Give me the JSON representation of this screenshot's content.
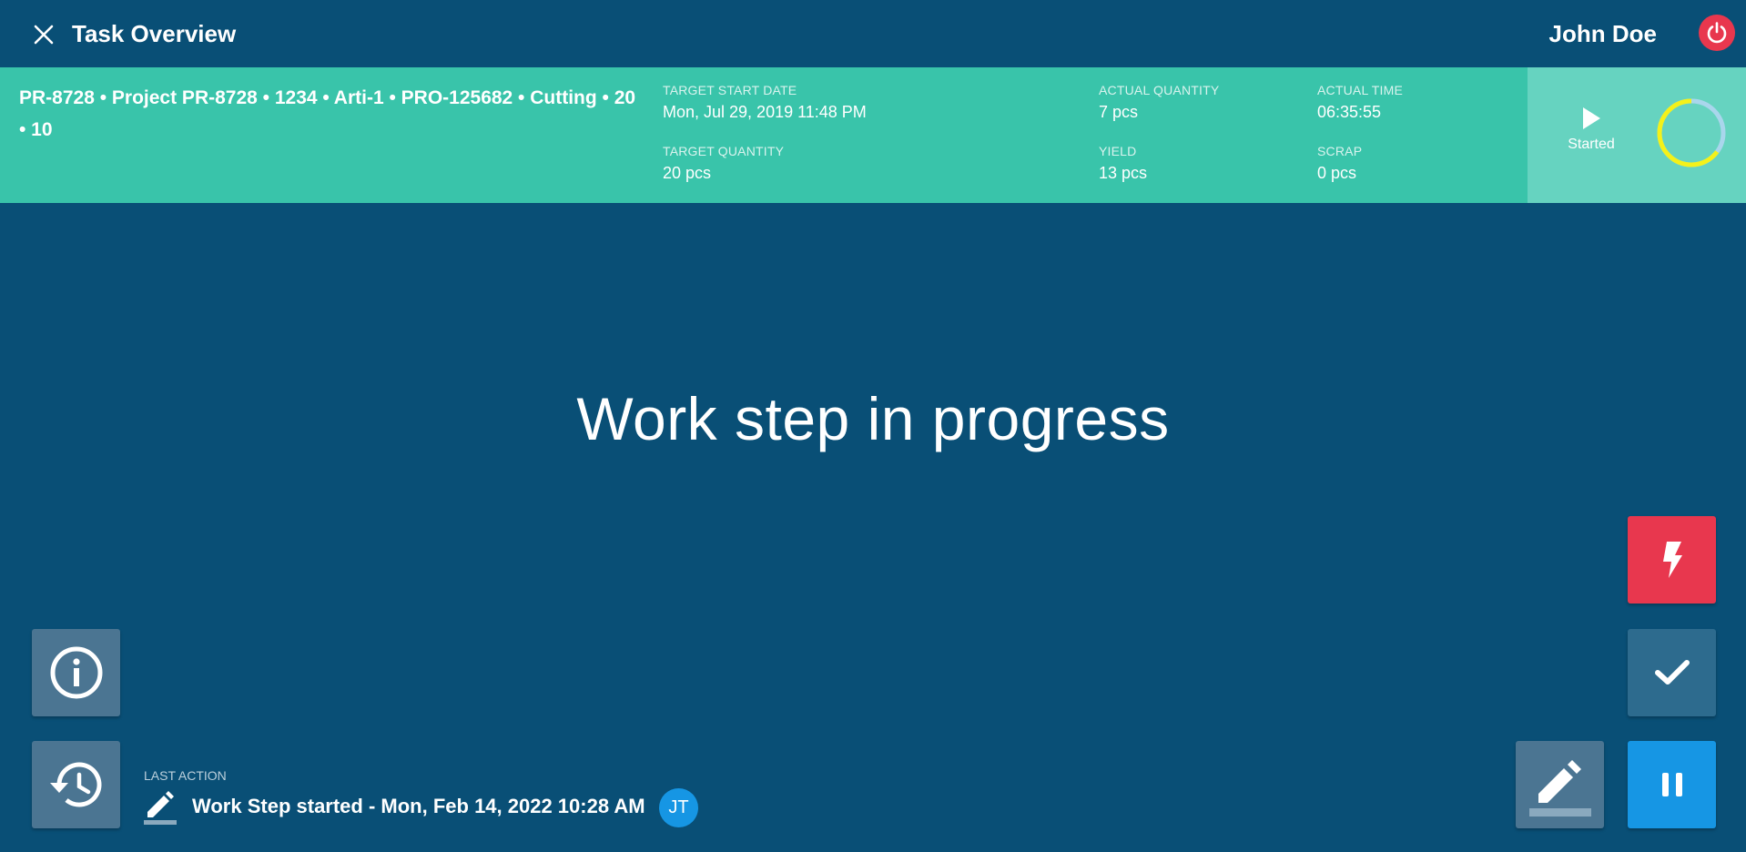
{
  "header": {
    "title": "Task Overview",
    "user_name": "John Doe"
  },
  "banner": {
    "order_description": "PR-8728 • Project PR-8728 • 1234 • Arti-1 • PRO-125682 • Cutting • 20 • 10",
    "fields": {
      "target_start_date": {
        "label": "TARGET START DATE",
        "value": "Mon, Jul 29, 2019 11:48 PM"
      },
      "target_quantity": {
        "label": "TARGET QUANTITY",
        "value": "20 pcs"
      },
      "actual_quantity": {
        "label": "ACTUAL QUANTITY",
        "value": "7 pcs"
      },
      "yield": {
        "label": "YIELD",
        "value": "13 pcs"
      },
      "actual_time": {
        "label": "ACTUAL TIME",
        "value": "06:35:55"
      },
      "scrap": {
        "label": "SCRAP",
        "value": "0 pcs"
      }
    },
    "status": {
      "label": "Started",
      "progress_fraction": 0.65
    }
  },
  "main": {
    "message": "Work step in progress"
  },
  "last_action": {
    "label": "LAST ACTION",
    "text": "Work Step started - Mon, Feb 14, 2022 10:28 AM",
    "user_initials": "JT"
  },
  "icons": {
    "close": "close-icon",
    "power": "power-icon",
    "play": "play-icon",
    "info": "info-icon",
    "history": "history-icon",
    "edit": "pencil-icon",
    "flash": "flash-icon",
    "check": "check-icon",
    "pause": "pause-icon"
  },
  "colors": {
    "background": "#094f76",
    "banner": "#39c4aa",
    "status_panel": "#66d3c0",
    "danger": "#e8374e",
    "primary": "#1696e4",
    "progress_ring": "#f4f11a",
    "progress_track": "#a9d6ec"
  }
}
